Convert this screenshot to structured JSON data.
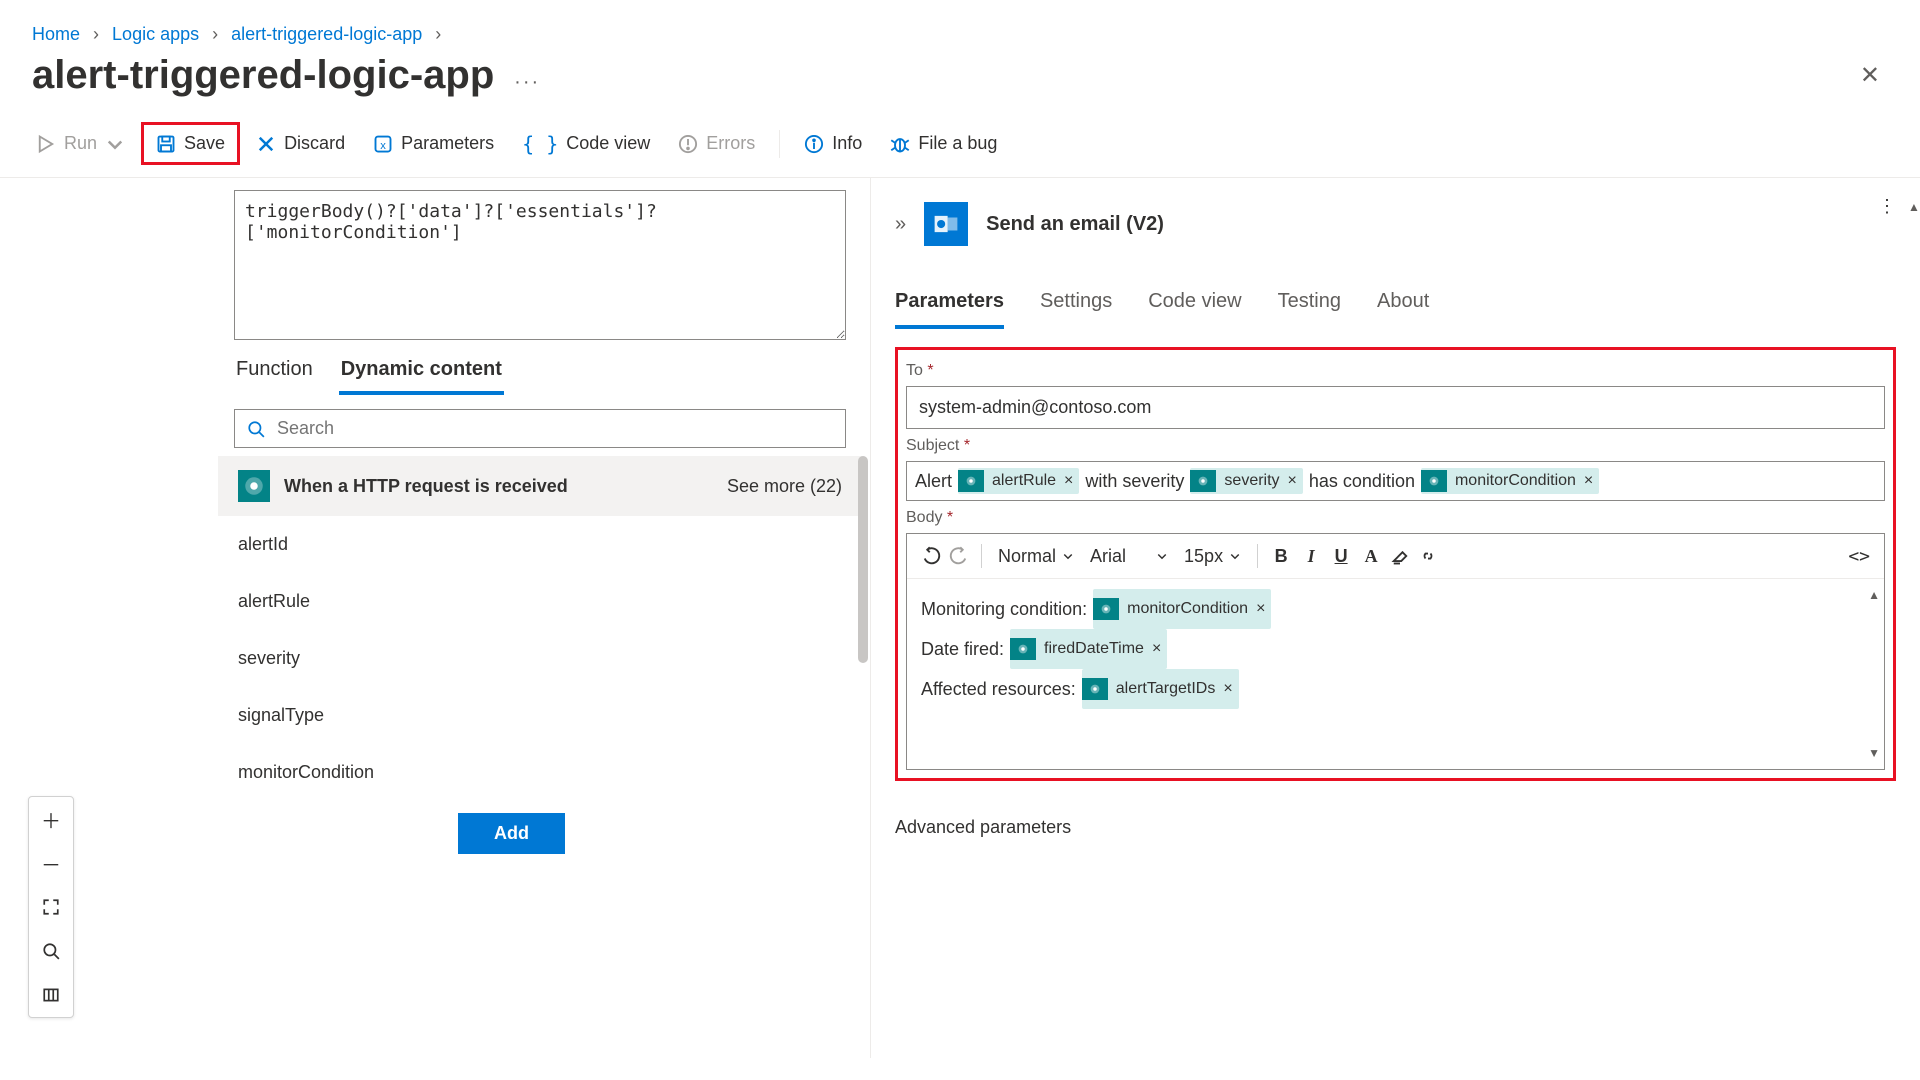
{
  "breadcrumb": [
    "Home",
    "Logic apps",
    "alert-triggered-logic-app"
  ],
  "page_title": "alert-triggered-logic-app",
  "toolbar": {
    "run": "Run",
    "save": "Save",
    "discard": "Discard",
    "parameters": "Parameters",
    "codeview": "Code view",
    "errors": "Errors",
    "info": "Info",
    "fileabug": "File a bug"
  },
  "expression_box": "triggerBody()?['data']?['essentials']?['monitorCondition']",
  "fn_tabs": {
    "function": "Function",
    "dynamic": "Dynamic content"
  },
  "search_placeholder": "Search",
  "dc_header_title": "When a HTTP request is received",
  "dc_seemore": "See more (22)",
  "dc_items": [
    "alertId",
    "alertRule",
    "severity",
    "signalType",
    "monitorCondition"
  ],
  "add_btn": "Add",
  "right": {
    "title": "Send an email (V2)",
    "tabs": [
      "Parameters",
      "Settings",
      "Code view",
      "Testing",
      "About"
    ],
    "to_label": "To",
    "to_value": "system-admin@contoso.com",
    "subject_label": "Subject",
    "subject_parts": {
      "t1": "Alert",
      "tok1": "alertRule",
      "t2": "with severity",
      "tok2": "severity",
      "t3": "has condition",
      "tok3": "monitorCondition"
    },
    "body_label": "Body",
    "body_toolbar": {
      "style": "Normal",
      "font": "Arial",
      "size": "15px"
    },
    "body_lines": {
      "l1": "Monitoring condition:",
      "l1_tok": "monitorCondition",
      "l2": "Date fired:",
      "l2_tok": "firedDateTime",
      "l3": "Affected resources:",
      "l3_tok": "alertTargetIDs"
    },
    "adv": "Advanced parameters"
  }
}
